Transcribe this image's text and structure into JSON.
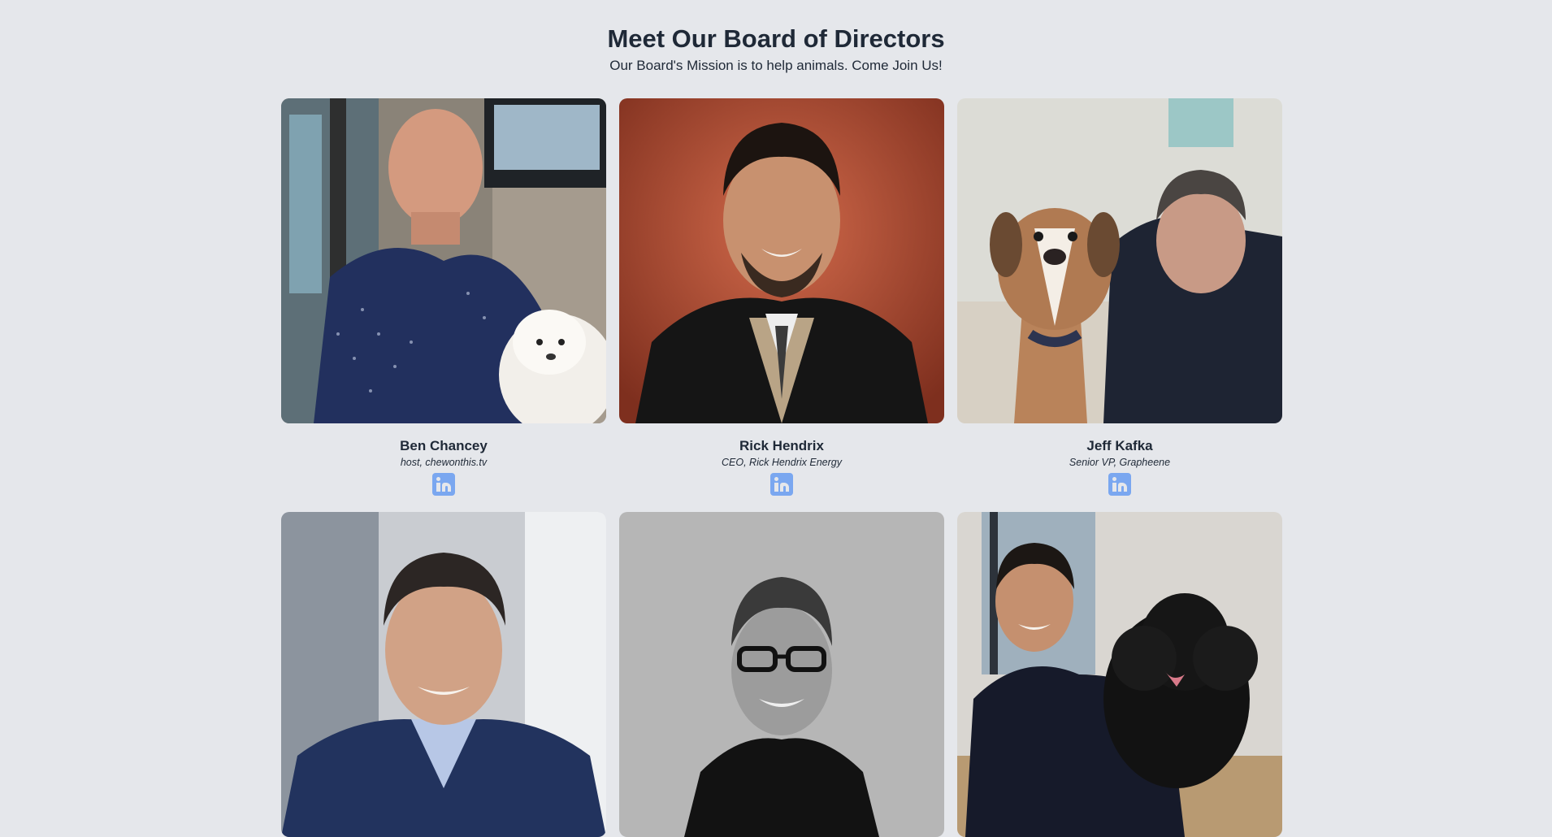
{
  "page": {
    "title": "Meet Our Board of Directors",
    "subtitle": "Our Board's Mission is to help animals. Come Join Us!"
  },
  "directors": [
    {
      "name": "Ben Chancey",
      "role": "host, chewonthis.tv",
      "icon": "linkedin-icon"
    },
    {
      "name": "Rick Hendrix",
      "role": "CEO, Rick Hendrix Energy",
      "icon": "linkedin-icon"
    },
    {
      "name": "Jeff Kafka",
      "role": "Senior VP, Grapheene",
      "icon": "linkedin-icon"
    },
    {
      "name": "",
      "role": "",
      "icon": ""
    },
    {
      "name": "",
      "role": "",
      "icon": ""
    },
    {
      "name": "",
      "role": "",
      "icon": ""
    }
  ],
  "colors": {
    "background": "#e5e7eb",
    "text": "#1f2937",
    "linkedin": "#7aa7f0"
  }
}
